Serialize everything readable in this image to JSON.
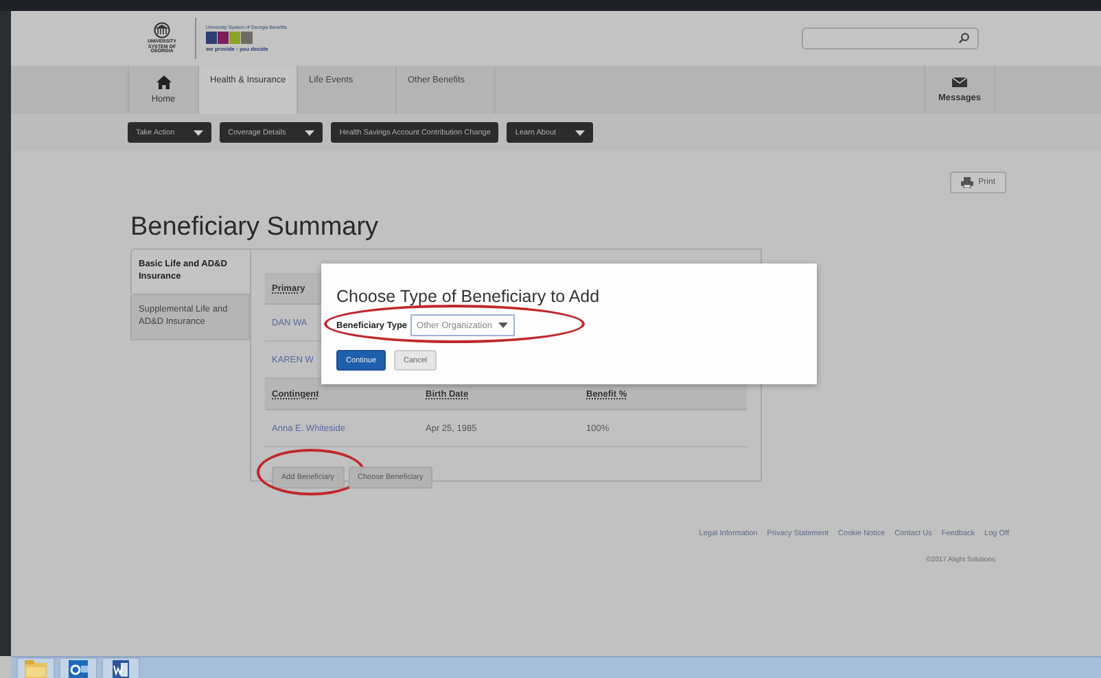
{
  "logo": {
    "emblem_text": "UNIVERSITY SYSTEM OF GEORGIA",
    "brand_title": "University System of Georgia Benefits",
    "tagline": "we provide - you decide"
  },
  "nav": {
    "home": "Home",
    "tabs": [
      {
        "label": "Health & Insurance",
        "selected": true
      },
      {
        "label": "Life Events",
        "selected": false
      },
      {
        "label": "Other Benefits",
        "selected": false
      }
    ],
    "messages": "Messages"
  },
  "action_menu": [
    {
      "label": "Take Action",
      "kind": "dropdown"
    },
    {
      "label": "Coverage Details",
      "kind": "dropdown"
    },
    {
      "label": "Health Savings Account Contribution Change",
      "kind": "link"
    },
    {
      "label": "Learn About",
      "kind": "dropdown"
    }
  ],
  "print_button": "Print",
  "page_title": "Beneficiary Summary",
  "coverage_tabs": [
    {
      "label": "Basic Life and AD&D Insurance",
      "selected": true
    },
    {
      "label": "Supplemental Life and AD&D Insurance",
      "selected": false
    }
  ],
  "primary": {
    "columns": [
      "Primary"
    ],
    "rows": [
      [
        "DAN WA"
      ],
      [
        "KAREN W"
      ]
    ]
  },
  "contingent": {
    "columns": [
      "Contingent",
      "Birth Date",
      "Benefit %"
    ],
    "rows": [
      [
        "Anna E. Whiteside",
        "Apr 25, 1985",
        "100%"
      ]
    ]
  },
  "buttons": [
    {
      "label": "Add Beneficiary",
      "highlighted": true
    },
    {
      "label": "Choose Beneficiary",
      "highlighted": false
    }
  ],
  "dialog": {
    "title": "Choose Type of Beneficiary to Add",
    "field_label": "Beneficiary Type",
    "value": "Other Organization",
    "highlighted": true,
    "buttons": [
      {
        "label": "Continue",
        "kind": "primary"
      },
      {
        "label": "Cancel",
        "kind": "secondary"
      }
    ]
  },
  "footer": {
    "links": [
      "Legal Information",
      "Privacy Statement",
      "Cookie Notice",
      "Contact Us",
      "Feedback",
      "Log Off"
    ],
    "copyright": "©2017 Alight Solutions"
  },
  "taskbar": {
    "apps": [
      {
        "kind": "folder"
      },
      {
        "kind": "mail"
      },
      {
        "kind": "document"
      }
    ]
  }
}
